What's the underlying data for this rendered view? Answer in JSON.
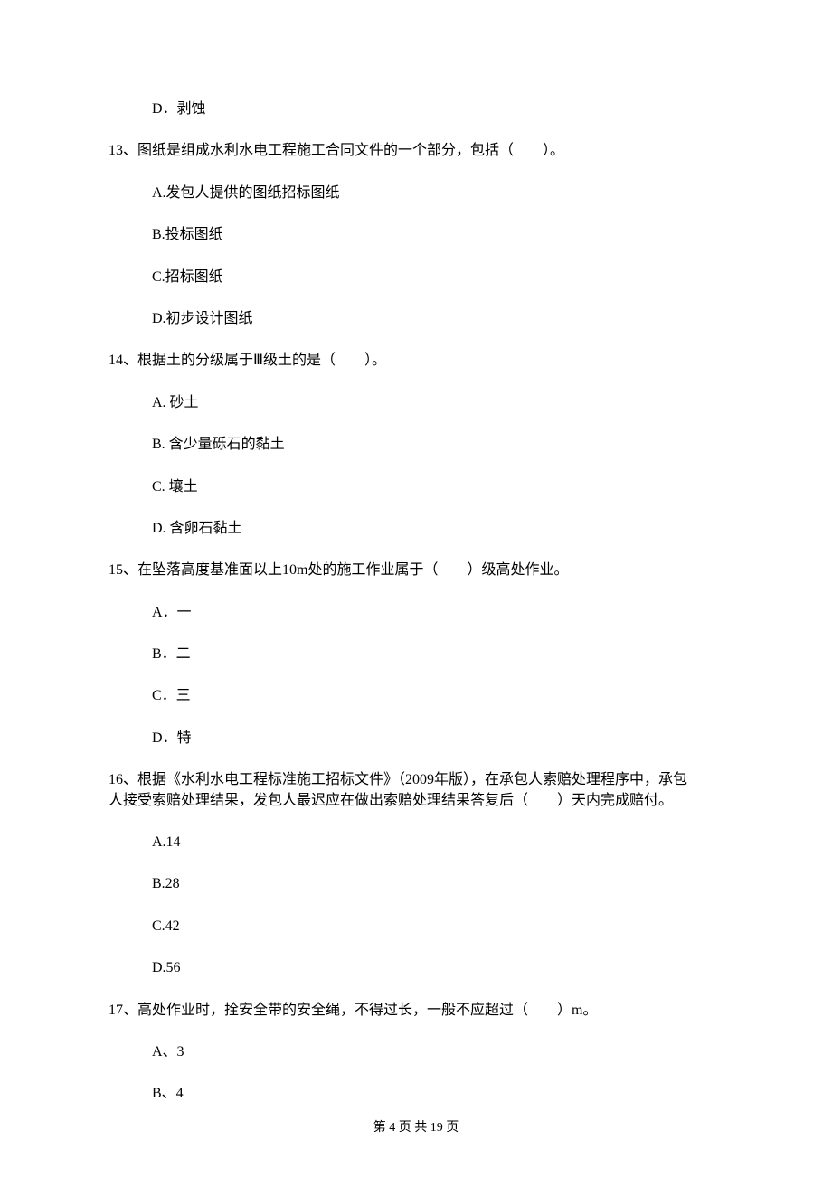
{
  "orphan_option": {
    "label": "D．剥蚀"
  },
  "questions": [
    {
      "number": "13、",
      "text": "图纸是组成水利水电工程施工合同文件的一个部分，包括（　　）。",
      "options": [
        "A.发包人提供的图纸招标图纸",
        "B.投标图纸",
        "C.招标图纸",
        "D.初步设计图纸"
      ]
    },
    {
      "number": "14、",
      "text": "根据土的分级属于Ⅲ级土的是（　　）。",
      "options": [
        "A. 砂土",
        "B. 含少量砾石的黏土",
        "C. 壤土",
        "D. 含卵石黏土"
      ]
    },
    {
      "number": "15、",
      "text": "在坠落高度基准面以上10m处的施工作业属于（　　）级高处作业。",
      "options": [
        "A．一",
        "B．二",
        "C．三",
        "D．特"
      ]
    },
    {
      "number": "16、",
      "text": "根据《水利水电工程标准施工招标文件》（2009年版），在承包人索赔处理程序中，承包",
      "text2": "人接受索赔处理结果，发包人最迟应在做出索赔处理结果答复后（　　）天内完成赔付。",
      "options": [
        "A.14",
        "B.28",
        "C.42",
        "D.56"
      ]
    },
    {
      "number": "17、",
      "text": "高处作业时，拴安全带的安全绳，不得过长，一般不应超过（　　）m。",
      "options": [
        "A、3",
        "B、4"
      ]
    }
  ],
  "footer": "第 4 页 共 19 页"
}
